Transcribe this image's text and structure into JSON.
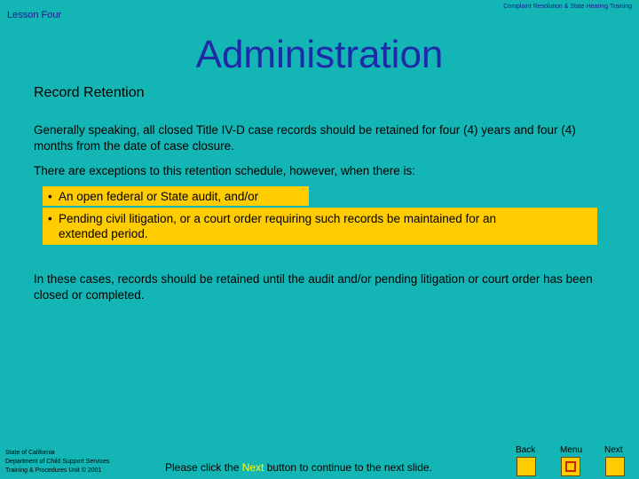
{
  "header": {
    "lesson": "Lesson Four",
    "course": "Complaint Resolution & State Hearing Training"
  },
  "title": "Administration",
  "section_heading": "Record Retention",
  "paragraphs": [
    "Generally speaking, all closed Title IV-D case records should be retained for four (4) years and four (4) months from the date of case closure.",
    "There are exceptions to this retention schedule, however, when there is:",
    "In these cases, records should be retained until the audit and/or pending litigation or court order has been closed or completed."
  ],
  "bullets": [
    {
      "marker": "•",
      "text": "An open federal or State audit, and/or"
    },
    {
      "marker": "•",
      "text_line1": "Pending civil litigation, or a court order requiring such records be maintained for an",
      "text_line2": "extended period."
    }
  ],
  "footer": {
    "org_line1": "State of California",
    "org_line2": "Department of Child Support Services",
    "org_line3": "Training & Procedures Unit  © 2001",
    "instruction_pre": "Please click the ",
    "instruction_highlight": "Next",
    "instruction_post": " button to continue to the next slide."
  },
  "nav": {
    "back_label": "Back",
    "menu_label": "Menu",
    "next_label": "Next"
  },
  "colors": {
    "background": "#14b5b5",
    "title": "#1e2aa8",
    "highlight_box": "#ffcc00",
    "next_highlight": "#ffff00"
  }
}
